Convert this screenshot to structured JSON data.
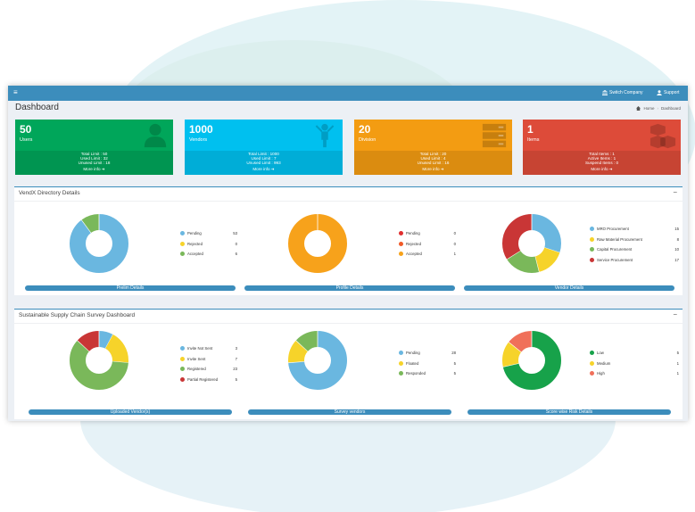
{
  "topbar": {
    "menu_icon": "menu-icon",
    "switch_company": "Switch Company",
    "support": "Support"
  },
  "page": {
    "title": "Dashboard",
    "breadcrumb_home": "Home",
    "breadcrumb_current": "Dashboard"
  },
  "stat_boxes": [
    {
      "number": "50",
      "label": "Users",
      "lines": [
        "Total Limit : 50",
        "Used Limit : 32",
        "Unused Limit : 18"
      ],
      "more": "More info",
      "color": "#00a65a",
      "icon": "user-icon"
    },
    {
      "number": "1000",
      "label": "Vendors",
      "lines": [
        "Total Limit : 1000",
        "Used Limit : 7",
        "Unused Limit : 993"
      ],
      "more": "More info",
      "color": "#00c0ef",
      "icon": "vendor-icon"
    },
    {
      "number": "20",
      "label": "Division",
      "lines": [
        "Total Limit : 20",
        "Used Limit : 4",
        "Unused Limit : 16"
      ],
      "more": "More info",
      "color": "#f39c12",
      "icon": "server-icon"
    },
    {
      "number": "1",
      "label": "Items",
      "lines": [
        "Total Items : 1",
        "Active Items : 1",
        "Suspend Items : 0"
      ],
      "more": "More info",
      "color": "#dd4b39",
      "icon": "cubes-icon"
    }
  ],
  "panels": [
    {
      "title": "VendX Directory Details",
      "minimize": "−",
      "charts": [
        {
          "bar_label": "Prelim Details",
          "items": [
            {
              "name": "Pending",
              "value": 53,
              "color": "#6ab7e0"
            },
            {
              "name": "Rejected",
              "value": 0,
              "color": "#f6d32a"
            },
            {
              "name": "Accepted",
              "value": 6,
              "color": "#7ab85a"
            }
          ]
        },
        {
          "bar_label": "Profile Details",
          "items": [
            {
              "name": "Pending",
              "value": 0,
              "color": "#e02f2f"
            },
            {
              "name": "Rejected",
              "value": 0,
              "color": "#f05a28"
            },
            {
              "name": "Accepted",
              "value": 1,
              "color": "#f7a21b"
            }
          ]
        },
        {
          "bar_label": "Vendor Details",
          "items": [
            {
              "name": "MRO Procurement",
              "value": 15,
              "color": "#6ab7e0"
            },
            {
              "name": "Raw Material Procurement",
              "value": 8,
              "color": "#f6d32a"
            },
            {
              "name": "Capital Procurement",
              "value": 10,
              "color": "#7ab85a"
            },
            {
              "name": "Service Procurement",
              "value": 17,
              "color": "#c93636"
            }
          ]
        }
      ]
    },
    {
      "title": "Sustainable Supply Chain Survey Dashboard",
      "minimize": "−",
      "charts": [
        {
          "bar_label": "Uploaded Vendor(s)",
          "items": [
            {
              "name": "Invite Not Sent",
              "value": 3,
              "color": "#6ab7e0"
            },
            {
              "name": "Invite Sent",
              "value": 7,
              "color": "#f6d32a"
            },
            {
              "name": "Registered",
              "value": 23,
              "color": "#7ab85a"
            },
            {
              "name": "Partial Registered",
              "value": 5,
              "color": "#c93636"
            }
          ]
        },
        {
          "bar_label": "Survey vendors",
          "items": [
            {
              "name": "Pending",
              "value": 28,
              "color": "#6ab7e0"
            },
            {
              "name": "Floated",
              "value": 5,
              "color": "#f6d32a"
            },
            {
              "name": "Responded",
              "value": 5,
              "color": "#7ab85a"
            }
          ]
        },
        {
          "bar_label": "Score wise Risk Details",
          "items": [
            {
              "name": "Low",
              "value": 5,
              "color": "#17a24a"
            },
            {
              "name": "Medium",
              "value": 1,
              "color": "#f6d32a"
            },
            {
              "name": "High",
              "value": 1,
              "color": "#f0705a"
            }
          ]
        }
      ]
    }
  ]
}
